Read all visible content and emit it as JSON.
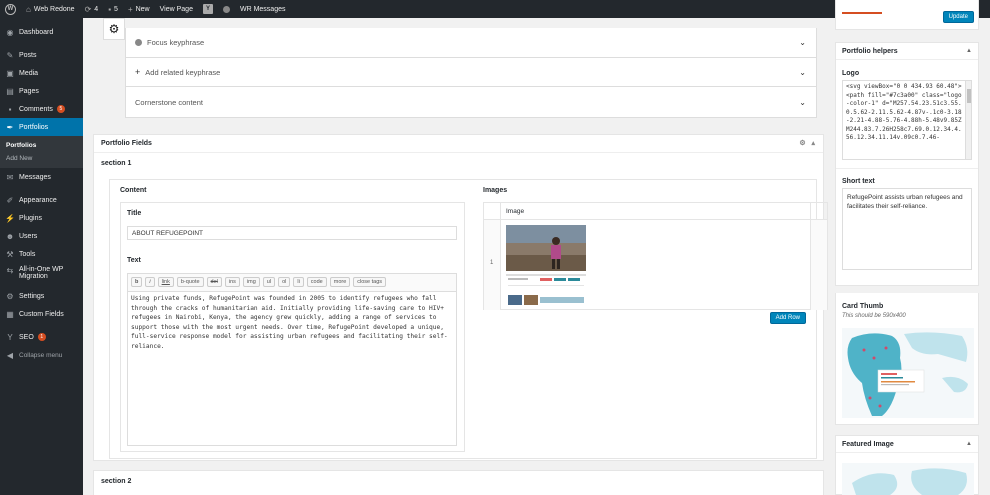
{
  "adminbar": {
    "site_name": "Web Redone",
    "updates_count": "4",
    "comments_count": "5",
    "new_label": "New",
    "view_page_label": "View Page",
    "wr_messages_label": "WR Messages"
  },
  "sidebar": {
    "dashboard": "Dashboard",
    "posts": "Posts",
    "media": "Media",
    "pages": "Pages",
    "comments": "Comments",
    "comments_badge": "5",
    "portfolios": "Portfolios",
    "sub_portfolios": "Portfolios",
    "sub_add_new": "Add New",
    "messages": "Messages",
    "appearance": "Appearance",
    "plugins": "Plugins",
    "users": "Users",
    "tools": "Tools",
    "all_in_one_line1": "All-in-One WP",
    "all_in_one_line2": "Migration",
    "settings": "Settings",
    "custom_fields": "Custom Fields",
    "seo": "SEO",
    "seo_badge": "1",
    "collapse": "Collapse menu"
  },
  "seo_panel": {
    "focus_keyphrase": "Focus keyphrase",
    "add_related": "Add related keyphrase",
    "cornerstone": "Cornerstone content"
  },
  "portfolio_fields": {
    "title": "Portfolio Fields",
    "section1": "section 1",
    "section2": "section 2",
    "content_col": "Content",
    "images_col": "Images",
    "title_label": "Title",
    "title_value": "ABOUT REFUGEPOINT",
    "text_label": "Text",
    "quicktags": [
      "b",
      "i",
      "link",
      "b-quote",
      "del",
      "ins",
      "img",
      "ul",
      "ol",
      "li",
      "code",
      "more",
      "close tags"
    ],
    "text_value": "Using private funds, RefugePoint was founded in 2005 to identify refugees who fall through the cracks of humanitarian aid. Initially providing life-saving care to HIV+ refugees in Nairobi, Kenya, the agency grew quickly, adding a range of services to support those with the most urgent needs. Over time, RefugePoint developed a unique, full-service response model for assisting urban refugees and facilitating their self-reliance.",
    "image_header": "Image",
    "row_number": "1",
    "add_row": "Add Row"
  },
  "right_panel": {
    "update_button": "Update",
    "helpers_title": "Portfolio helpers",
    "logo_label": "Logo",
    "logo_code": "<svg viewBox=\"0 0 434.93 60.48\"><path fill=\"#7c3a00\" class=\"logo-color-1\" d=\"M257.54.23.51c3.55.0.5.62-2.11.5.62-4.87v-.1c0-3.18-2.21-4.88-5.76-4.88h-5.48v9.85ZM244.83.7.26H258c7.69.0.12.34.4.56.12.34.11.14v.09c0.7.46-",
    "short_text_label": "Short text",
    "short_text_value": "RefugePoint assists urban refugees and facilitates their self-reliance.",
    "card_thumb_label": "Card Thumb",
    "card_thumb_hint": "This should be 590x400",
    "featured_image_title": "Featured Image"
  },
  "colors": {
    "admin_dark": "#23282d",
    "accent_blue": "#0073aa",
    "badge_orange": "#d54e21",
    "map_teal": "#4fb3c8"
  }
}
